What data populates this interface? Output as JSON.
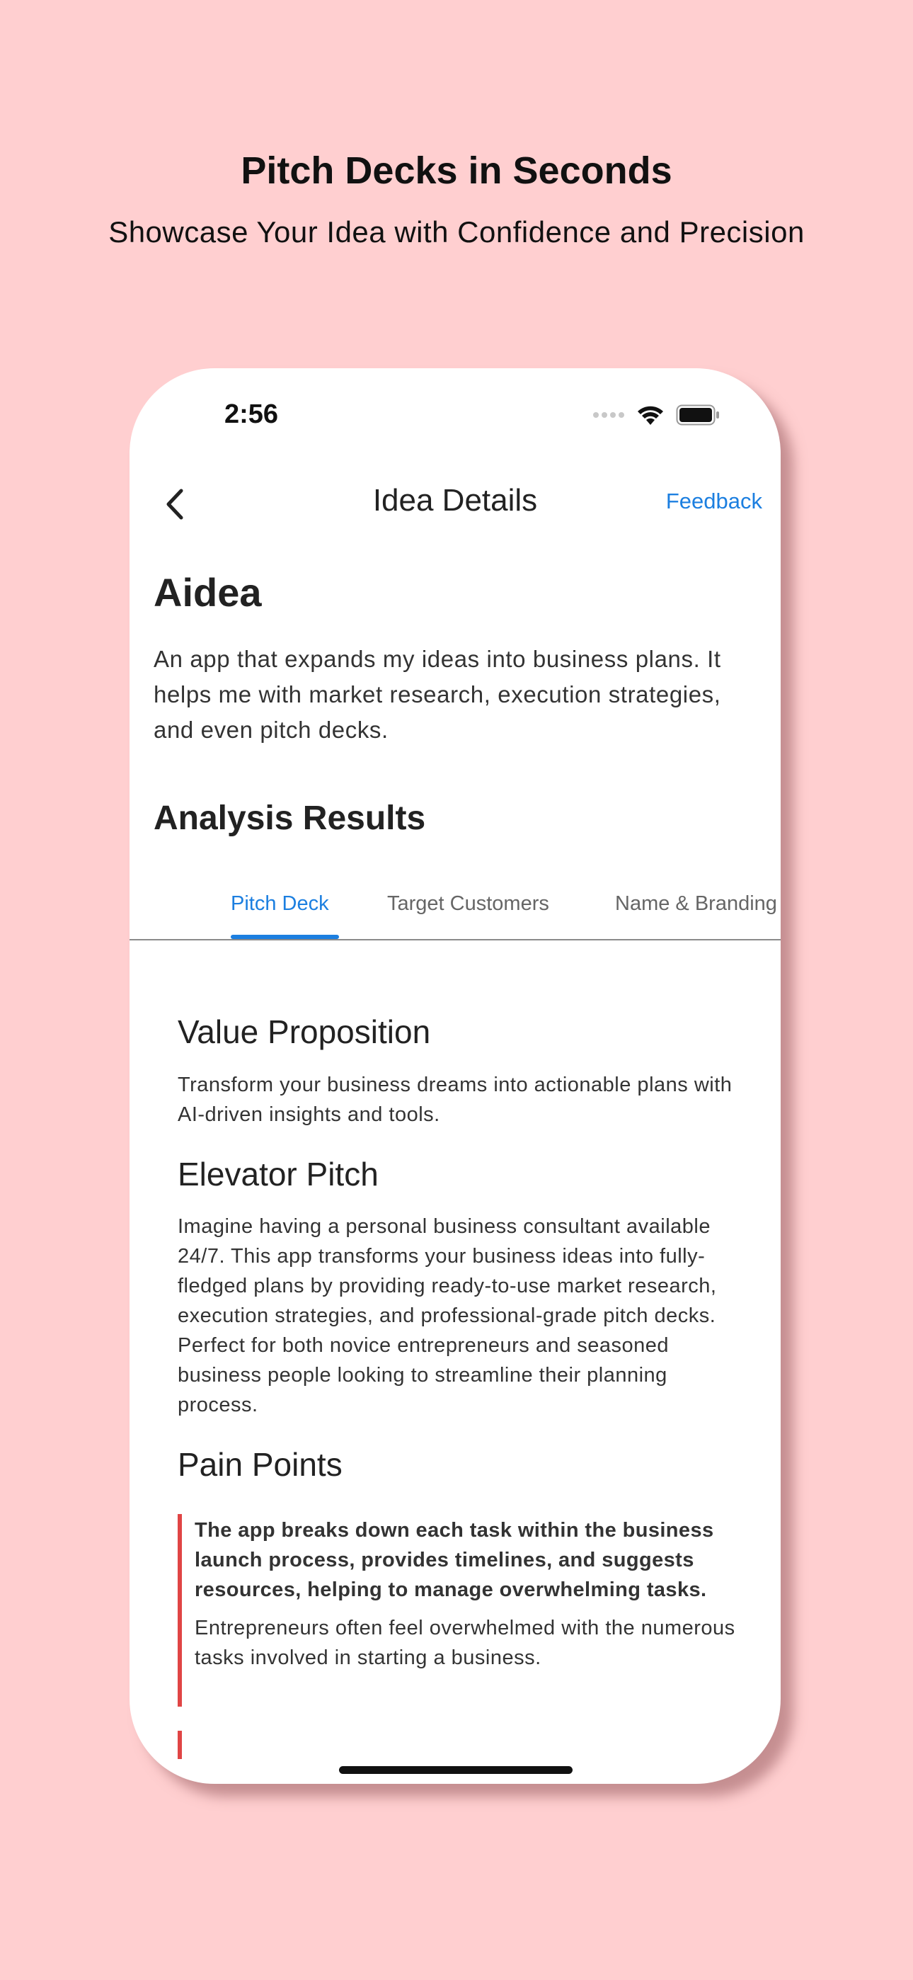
{
  "promo": {
    "title": "Pitch Decks in Seconds",
    "subtitle": "Showcase Your Idea with Confidence and Precision"
  },
  "status_bar": {
    "time": "2:56",
    "icons": [
      "cellular-dots-icon",
      "wifi-icon",
      "battery-icon"
    ]
  },
  "nav": {
    "back_icon": "chevron-left-icon",
    "title": "Idea Details",
    "feedback_label": "Feedback"
  },
  "idea": {
    "name": "Aidea",
    "description": "An app that expands my ideas into business plans. It helps me with market research, execution strategies, and even pitch decks."
  },
  "analysis": {
    "title": "Analysis Results",
    "tabs": [
      {
        "label": "Pitch Deck",
        "active": true
      },
      {
        "label": "Target Customers",
        "active": false
      },
      {
        "label": "Name & Branding",
        "active": false
      }
    ]
  },
  "pitch_deck": {
    "value_proposition": {
      "heading": "Value Proposition",
      "text": "Transform your business dreams into actionable plans with AI-driven insights and tools."
    },
    "elevator_pitch": {
      "heading": "Elevator Pitch",
      "text": "Imagine having a personal business consultant available 24/7. This app transforms your business ideas into fully-fledged plans by providing ready-to-use market research, execution strategies, and professional-grade pitch decks. Perfect for both novice entrepreneurs and seasoned business people looking to streamline their planning process."
    },
    "pain_points": {
      "heading": "Pain Points",
      "items": [
        {
          "solution": "The app breaks down each task within the business launch process, provides timelines, and suggests resources, helping to manage overwhelming tasks.",
          "problem": "Entrepreneurs often feel overwhelmed with the numerous tasks involved in starting a business."
        }
      ]
    }
  },
  "colors": {
    "background": "#FFCFD0",
    "accent": "#1C7FE0",
    "pain_bar": "#E04545"
  }
}
